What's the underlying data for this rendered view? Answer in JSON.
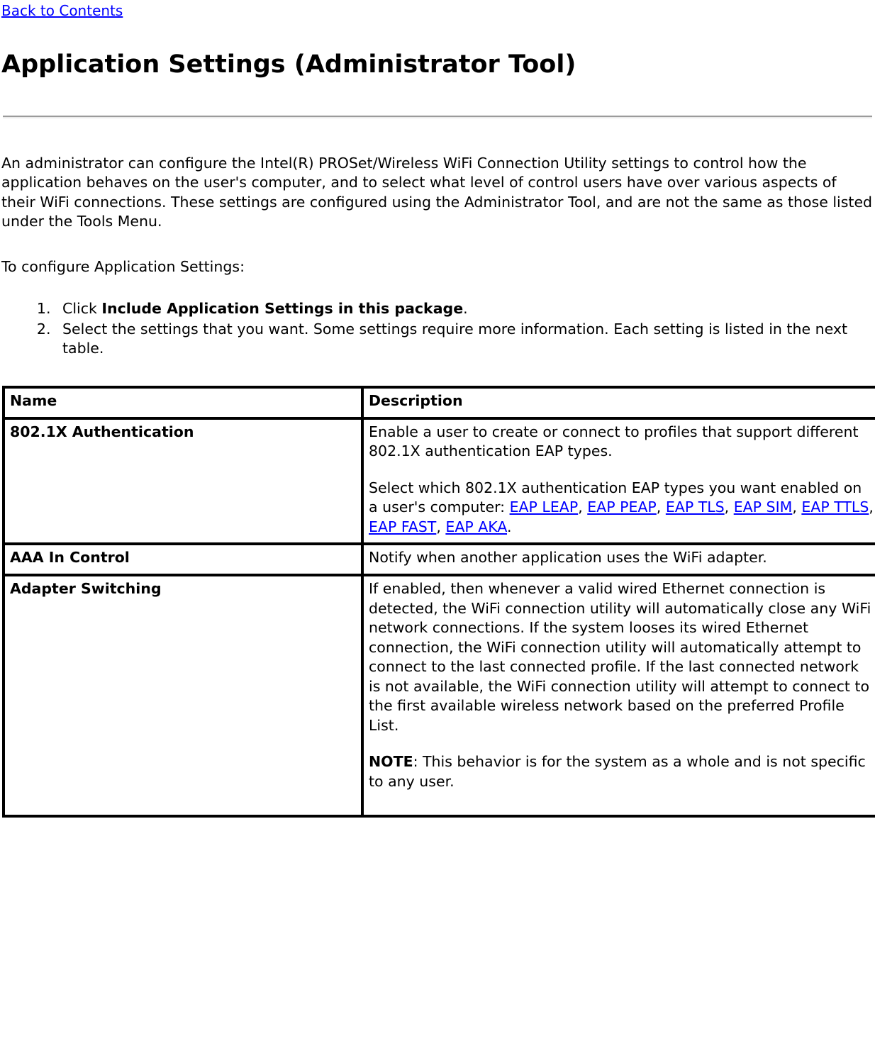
{
  "nav": {
    "back_link": "Back to Contents"
  },
  "header": {
    "title": "Application Settings (Administrator Tool)"
  },
  "intro": {
    "paragraph": "An administrator can configure the Intel(R) PROSet/Wireless WiFi Connection Utility settings to control how the application behaves on the user's computer, and to select what level of control users have over various aspects of their WiFi connections. These settings are configured using the Administrator Tool, and are not the same as those listed under the Tools Menu.",
    "lead_in": "To configure Application Settings:"
  },
  "steps": {
    "step1_prefix": "Click ",
    "step1_bold": "Include Application Settings in this package",
    "step1_suffix": ".",
    "step2": "Select the settings that you want. Some settings require more information. Each setting is listed in the next table."
  },
  "table": {
    "headers": {
      "name": "Name",
      "description": "Description"
    },
    "rows": [
      {
        "name": "802.1X Authentication",
        "desc_para1": "Enable a user to create or connect to profiles that support different 802.1X authentication EAP types.",
        "desc_para2_prefix": "Select which 802.1X authentication EAP types you want enabled on a user's computer: ",
        "desc_links": [
          "EAP LEAP",
          "EAP PEAP",
          "EAP TLS",
          "EAP SIM",
          "EAP TTLS",
          "EAP FAST",
          "EAP AKA"
        ],
        "desc_para2_suffix": "."
      },
      {
        "name": "AAA In Control",
        "desc_para1": "Notify when another application uses the WiFi adapter."
      },
      {
        "name": "Adapter Switching",
        "desc_para1": "If enabled, then whenever a valid wired Ethernet connection is detected, the WiFi connection utility will automatically close any WiFi network connections. If the system looses its wired Ethernet connection, the WiFi connection utility will automatically attempt to connect to the last connected profile. If the last connected network is not available, the WiFi connection utility will attempt to connect to the first available wireless network based on the preferred Profile List.",
        "note_label": "NOTE",
        "note_text": ": This behavior is for the system as a whole and is not specific to any user."
      }
    ]
  },
  "colors": {
    "link": "#0000FF",
    "text": "#000000",
    "rule": "#9B9B9B",
    "background": "#FFFFFF"
  }
}
